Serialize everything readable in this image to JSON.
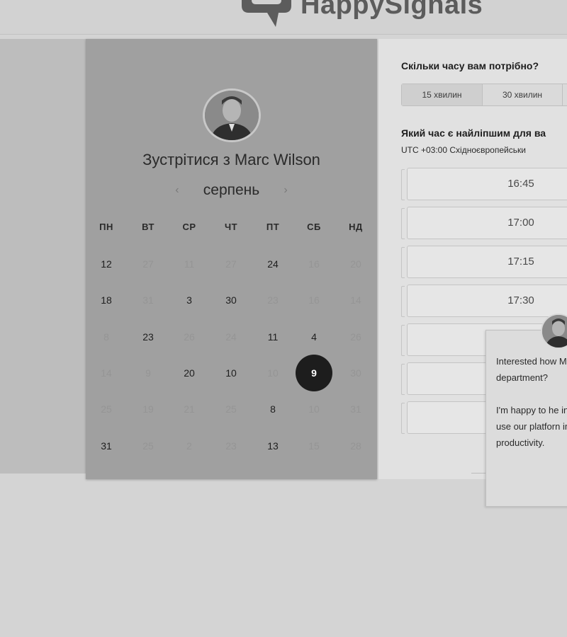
{
  "header": {
    "logo_text": "HappySignals"
  },
  "calendar": {
    "meet_title": "Зустрітися з Marc Wilson",
    "month_label": "серпень",
    "prev_arrow": "‹",
    "next_arrow": "›",
    "weekdays": [
      "ПН",
      "ВТ",
      "СР",
      "ЧТ",
      "ПТ",
      "СБ",
      "НД"
    ],
    "weeks": [
      [
        {
          "d": "12",
          "a": true
        },
        {
          "d": "27",
          "a": false
        },
        {
          "d": "11",
          "a": false
        },
        {
          "d": "27",
          "a": false
        },
        {
          "d": "24",
          "a": true
        },
        {
          "d": "16",
          "a": false
        },
        {
          "d": "20",
          "a": false
        }
      ],
      [
        {
          "d": "18",
          "a": true
        },
        {
          "d": "31",
          "a": false
        },
        {
          "d": "3",
          "a": true
        },
        {
          "d": "30",
          "a": true
        },
        {
          "d": "23",
          "a": false
        },
        {
          "d": "16",
          "a": false
        },
        {
          "d": "14",
          "a": false
        }
      ],
      [
        {
          "d": "8",
          "a": false
        },
        {
          "d": "23",
          "a": true
        },
        {
          "d": "26",
          "a": false
        },
        {
          "d": "24",
          "a": false
        },
        {
          "d": "11",
          "a": true
        },
        {
          "d": "4",
          "a": true
        },
        {
          "d": "26",
          "a": false
        }
      ],
      [
        {
          "d": "14",
          "a": false
        },
        {
          "d": "9",
          "a": false
        },
        {
          "d": "20",
          "a": true
        },
        {
          "d": "10",
          "a": true
        },
        {
          "d": "10",
          "a": false
        },
        {
          "d": "9",
          "a": true,
          "selected": true
        },
        {
          "d": "30",
          "a": false
        }
      ],
      [
        {
          "d": "25",
          "a": false
        },
        {
          "d": "19",
          "a": false
        },
        {
          "d": "21",
          "a": false
        },
        {
          "d": "25",
          "a": false
        },
        {
          "d": "8",
          "a": true
        },
        {
          "d": "10",
          "a": false
        },
        {
          "d": "31",
          "a": false
        }
      ],
      [
        {
          "d": "31",
          "a": true
        },
        {
          "d": "25",
          "a": false
        },
        {
          "d": "2",
          "a": false
        },
        {
          "d": "23",
          "a": false
        },
        {
          "d": "13",
          "a": true
        },
        {
          "d": "15",
          "a": false
        },
        {
          "d": "28",
          "a": false
        }
      ]
    ]
  },
  "booking": {
    "duration_question": "Скільки часу вам потрібно?",
    "durations": [
      "15 хвилин",
      "30 хвилин"
    ],
    "time_question": "Який час є найліпшим для ва",
    "timezone": "UTC +03:00 Східноєвропейськи",
    "slots": [
      "16:45",
      "17:00",
      "17:15",
      "17:30",
      "",
      "",
      ""
    ]
  },
  "chat": {
    "paragraph1": "Interested how Management co department?",
    "paragraph2": "I'm happy to he insight into how use our platforn improvement in productivity."
  },
  "colors": {
    "selected_day_bg": "#1d1d1d",
    "calendar_bg": "#a0a0a0",
    "page_bg": "#d4d4d4"
  },
  "icons": [
    "logo-speech-bubble-icon",
    "chevron-left-icon",
    "chevron-right-icon",
    "avatar-photo"
  ]
}
